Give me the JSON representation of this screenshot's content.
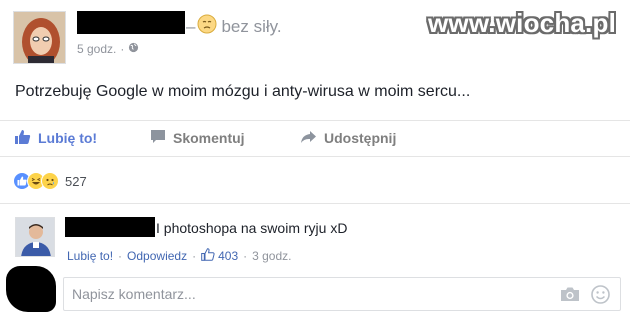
{
  "post": {
    "feeling_dash": "–",
    "feeling_text": "bez siły.",
    "timestamp": "5 godz.",
    "meta_separator": "·",
    "body": "Potrzebuję Google w moim mózgu i anty-wirusa w moim sercu..."
  },
  "watermark": "www.wiocha.pl",
  "actions": {
    "like_label": "Lubię to!",
    "comment_label": "Skomentuj",
    "share_label": "Udostępnij"
  },
  "reactions": {
    "count": "527",
    "types": [
      "like",
      "haha",
      "sad"
    ]
  },
  "comment": {
    "text": "I photoshopa na swoim ryju xD",
    "like_label": "Lubię to!",
    "reply_label": "Odpowiedz",
    "separator": "·",
    "like_count": "403",
    "time": "3 godz."
  },
  "composer": {
    "placeholder": "Napisz komentarz..."
  },
  "colors": {
    "facebook_blue": "#4267b2",
    "like_blue": "#5890ff",
    "muted_gray": "#90949c"
  }
}
